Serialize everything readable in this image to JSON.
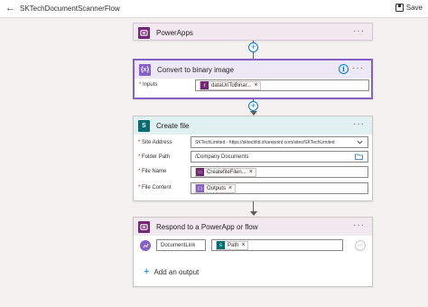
{
  "header": {
    "back_glyph": "←",
    "flow_name": "SKTechDocumentScannerFlow",
    "save_label": "Save"
  },
  "steps": {
    "powerapps": {
      "title": "PowerApps",
      "more": "···",
      "color": "#742774"
    },
    "convert": {
      "title": "Convert to binary image",
      "more": "···",
      "info": "i",
      "color": "#8661c5",
      "inputs_label": "Inputs",
      "token_label": "dataUriToBinar...",
      "token_remove": "×"
    },
    "create": {
      "title": "Create file",
      "more": "···",
      "color": "#036c70",
      "site_label": "Site Address",
      "site_value": "SKTechLimited - https://sktechltd.sharepoint.com/sites/SKTechLimited",
      "folder_label": "Folder Path",
      "folder_value": "/Company Documents",
      "name_label": "File Name",
      "name_token": "CreatefileFilen...",
      "content_label": "File Content",
      "content_token": "Outputs",
      "token_remove": "×"
    },
    "respond": {
      "title": "Respond to a PowerApp or flow",
      "more": "···",
      "color": "#742774",
      "output_key": "DocumentLink",
      "output_token": "Path",
      "token_remove": "×",
      "row_more": "···",
      "add_label": "Add an output"
    }
  },
  "required_mark": "*",
  "icons": {
    "powerapps": "powerapps-icon",
    "convert": "data-operation-icon",
    "sharepoint": "sharepoint-icon",
    "plus": "plus-icon",
    "info": "info-icon",
    "chevron": "chevron-down-icon",
    "folder": "folder-icon"
  }
}
